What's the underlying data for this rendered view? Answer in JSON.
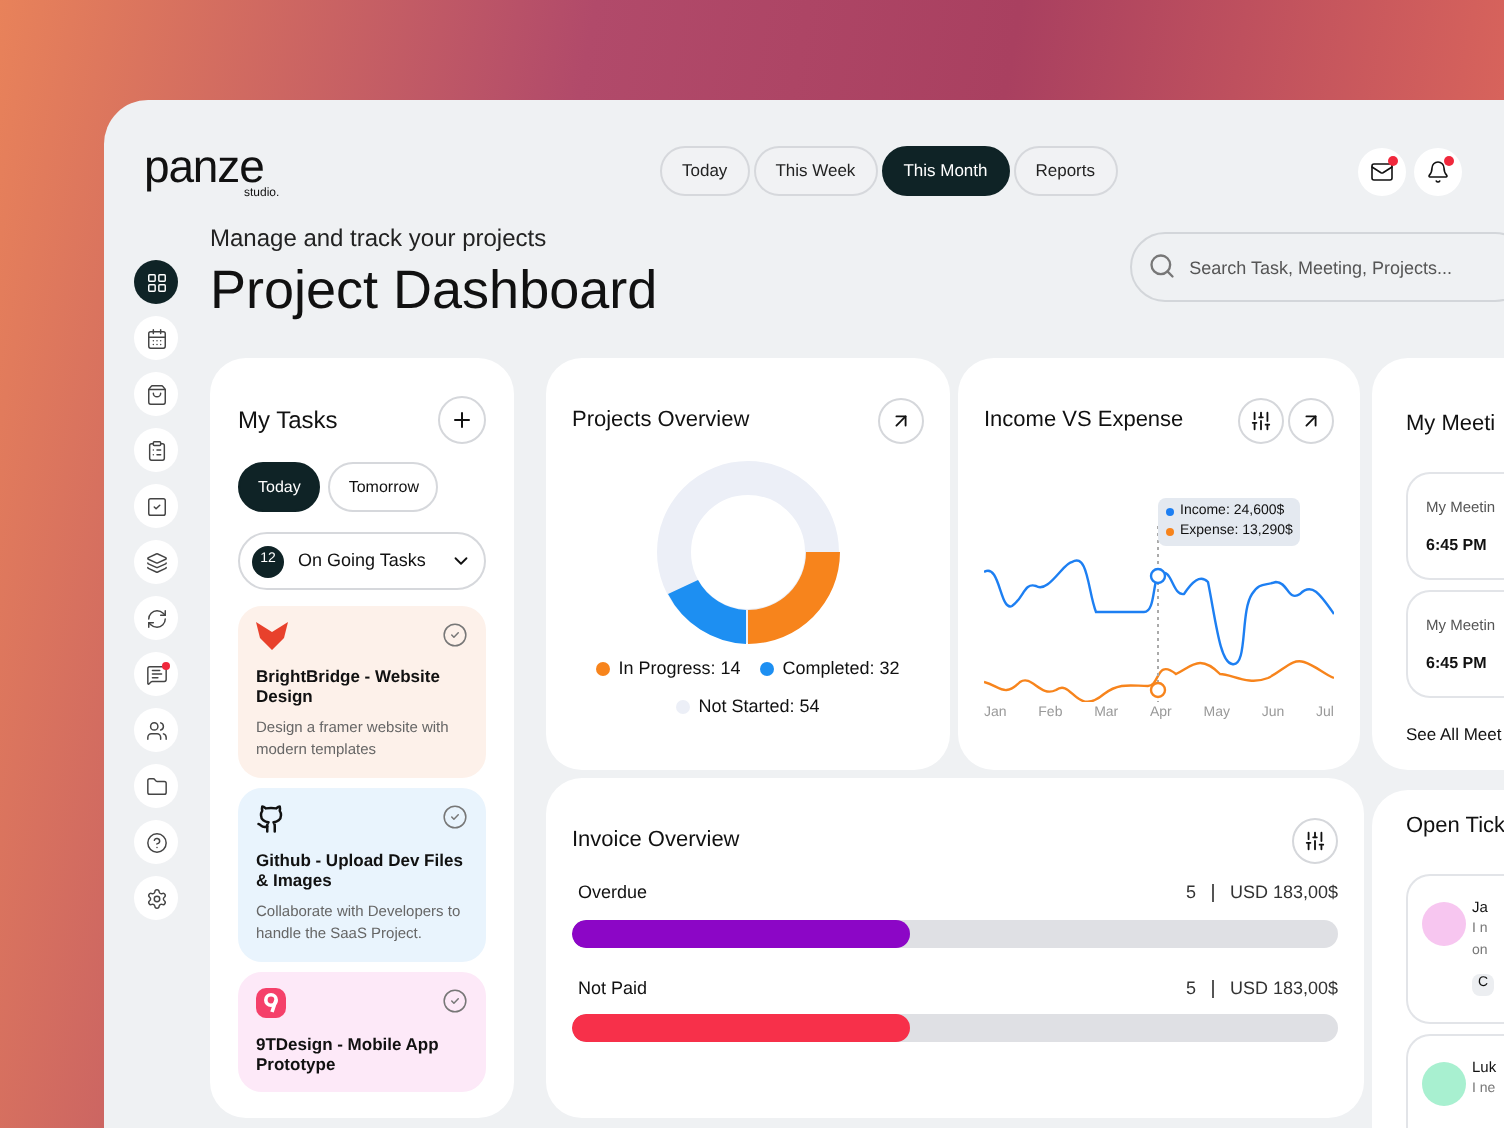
{
  "logo": {
    "name": "panze",
    "sub": "studio."
  },
  "period_tabs": [
    {
      "label": "Today",
      "selected": false
    },
    {
      "label": "This Week",
      "selected": false
    },
    {
      "label": "This Month",
      "selected": true
    },
    {
      "label": "Reports",
      "selected": false
    }
  ],
  "header_icons": [
    {
      "kind": "mail",
      "badge": true
    },
    {
      "kind": "bell",
      "badge": true
    }
  ],
  "sidebar": {
    "items": [
      {
        "kind": "grid",
        "selected": true,
        "badge": false
      },
      {
        "kind": "calendar",
        "selected": false,
        "badge": false
      },
      {
        "kind": "bag",
        "selected": false,
        "badge": false
      },
      {
        "kind": "clipboard",
        "selected": false,
        "badge": false
      },
      {
        "kind": "check",
        "selected": false,
        "badge": false
      },
      {
        "kind": "layers",
        "selected": false,
        "badge": false
      },
      {
        "kind": "swap",
        "selected": false,
        "badge": false
      },
      {
        "kind": "chat",
        "selected": false,
        "badge": true
      },
      {
        "kind": "users",
        "selected": false,
        "badge": false
      },
      {
        "kind": "folder",
        "selected": false,
        "badge": false
      },
      {
        "kind": "help",
        "selected": false,
        "badge": false
      },
      {
        "kind": "settings",
        "selected": false,
        "badge": false
      }
    ]
  },
  "page": {
    "subtitle": "Manage and track your projects",
    "title": "Project Dashboard",
    "search_placeholder": "Search Task, Meeting, Projects..."
  },
  "my_tasks": {
    "title": "My Tasks",
    "day_tabs": [
      {
        "label": "Today",
        "selected": true
      },
      {
        "label": "Tomorrow",
        "selected": false
      }
    ],
    "filter": {
      "count": "12",
      "label": "On Going Tasks"
    },
    "tasks": [
      {
        "kind": "fox",
        "title": "BrightBridge - Website Design",
        "description": "Design a framer website with modern templates",
        "color": "#fdf1ea"
      },
      {
        "kind": "github",
        "title": "Github - Upload Dev Files & Images",
        "description": "Collaborate with Developers to handle the SaaS Project.",
        "color": "#e9f4fd"
      },
      {
        "kind": "nine",
        "title": "9TDesign - Mobile App Prototype",
        "color": "#fde9f8"
      }
    ]
  },
  "projects_overview": {
    "title": "Projects Overview",
    "legend": [
      {
        "label": "In Progress: 14",
        "color": "#f7841c"
      },
      {
        "label": "Completed: 32",
        "color": "#1d8ff2"
      },
      {
        "label": "Not Started: 54",
        "color": "#eceff7"
      }
    ]
  },
  "income_expense": {
    "title": "Income VS Expense",
    "tooltip": [
      {
        "label": "Income: 24,600$",
        "color": "#1d7ff2"
      },
      {
        "label": "Expense: 13,290$",
        "color": "#f7841c"
      }
    ],
    "months": [
      "Jan",
      "Feb",
      "Mar",
      "Apr",
      "May",
      "Jun",
      "Jul"
    ]
  },
  "invoice_overview": {
    "title": "Invoice Overview",
    "rows": [
      {
        "label": "Overdue",
        "count": "5",
        "amount": "USD 183,00$",
        "level": 0.44,
        "color": "#8c06c6"
      },
      {
        "label": "Not Paid",
        "count": "5",
        "amount": "USD 183,00$",
        "level": 0.44,
        "color": "#f7304a"
      }
    ]
  },
  "meetings": {
    "title": "My Meeti",
    "items": [
      {
        "title": "My Meetin",
        "time": "6:45 PM"
      },
      {
        "title": "My Meetin",
        "time": "6:45 PM"
      }
    ],
    "see_all": "See All Meet"
  },
  "tickets": {
    "title": "Open Tick",
    "items": [
      {
        "name": "Ja",
        "lines": [
          "I n",
          "on"
        ],
        "chip": "C",
        "color": "#f7c6f0"
      },
      {
        "name": "Luk",
        "lines": [
          "I ne"
        ],
        "color": "#a8f0d0"
      }
    ]
  }
}
